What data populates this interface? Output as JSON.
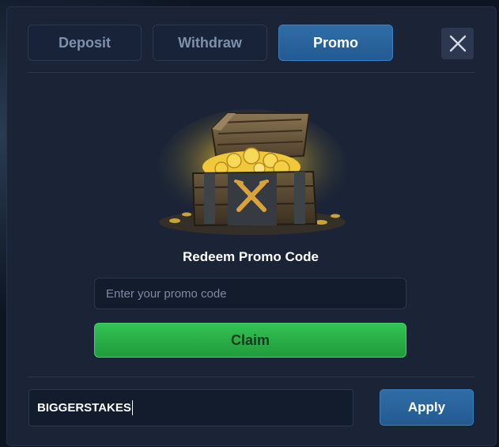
{
  "tabs": [
    {
      "label": "Deposit",
      "active": false
    },
    {
      "label": "Withdraw",
      "active": false
    },
    {
      "label": "Promo",
      "active": true
    }
  ],
  "icons": {
    "close": "close-icon",
    "chest": "treasure-chest-icon"
  },
  "promo": {
    "heading": "Redeem Promo Code",
    "placeholder": "Enter your promo code",
    "value": "",
    "claim_label": "Claim"
  },
  "code_entry": {
    "value": "BIGGERSTAKES",
    "apply_label": "Apply"
  },
  "colors": {
    "modal_bg": "#1a2436",
    "accent_blue": "#2f6da8",
    "claim_green": "#34c255"
  }
}
